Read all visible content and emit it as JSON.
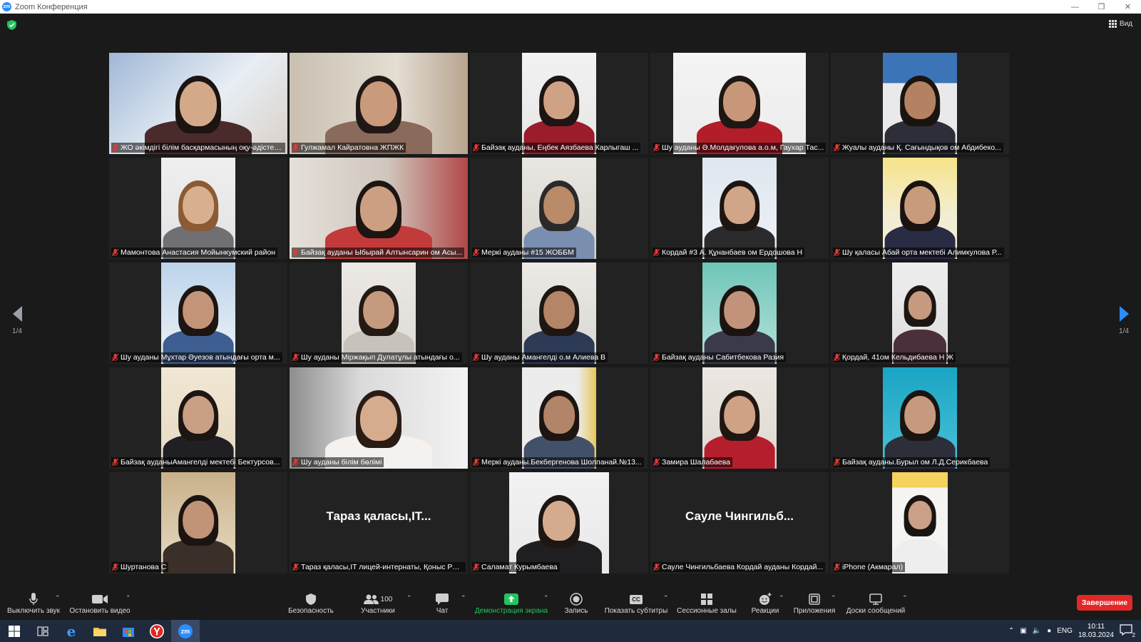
{
  "window": {
    "title": "Zoom Конференция",
    "app_icon": "zm"
  },
  "header": {
    "view_label": "Вид"
  },
  "nav": {
    "left_page": "1/4",
    "right_page": "1/4"
  },
  "participants": [
    {
      "name": "ЖО әкімдігі білім басқармасының оқу-әдістеме...",
      "active": true,
      "video": true
    },
    {
      "name": "Гулжамал Кайратовна ЖПЖК",
      "video": true
    },
    {
      "name": "Байзақ ауданы, Еңбек Аязбаева Карлыгаш ...",
      "video": true
    },
    {
      "name": "Шу ауданы Ә.Молдағулова а.о.м, Гаухар Тас...",
      "video": true
    },
    {
      "name": "Жуалы ауданы Қ. Сағындықов ом Абдибеко...",
      "video": true
    },
    {
      "name": "Мамонтова Анастасия Мойынкумский район",
      "video": true
    },
    {
      "name": "Байзақ ауданы Ыбырай Алтынсарин ом Асы...",
      "video": true
    },
    {
      "name": "Меркі ауданы #15 ЖОББМ",
      "video": true
    },
    {
      "name": "Кордай #3 А. Құнанбаев ом Ердошова Н",
      "video": true
    },
    {
      "name": "Шу қаласы Абай орта мектебі Алимкулова Р...",
      "video": true
    },
    {
      "name": "Шу ауданы Мұхтар Әуезов атындағы орта м...",
      "video": true
    },
    {
      "name": "Шу ауданы Міржақып Дулатұлы  атындағы о...",
      "video": true
    },
    {
      "name": "Шу ауданы Амангелді о.м Алиева В",
      "video": true
    },
    {
      "name": "Байзақ ауданы Сабитбекова Разия",
      "video": true
    },
    {
      "name": "Қордай, 41ом Кельдибаева Н Ж",
      "video": true
    },
    {
      "name": "Байзақ ауданыАмангелді мектебі Бектурсов...",
      "video": true
    },
    {
      "name": "Шу ауданы білім бөлімі",
      "video": true
    },
    {
      "name": "Меркі ауданы.Бекбергенова Шолпанай.№13...",
      "video": true
    },
    {
      "name": "Замира Шалабаева",
      "video": true
    },
    {
      "name": "Байзақ ауданы.Бурыл ом Л.Д.Серикбаева",
      "video": true
    },
    {
      "name": "Шуртанова С",
      "video": true
    },
    {
      "name": "Тараз қаласы,IT лицей-интернаты, Қоныс Рах...",
      "video": false,
      "display_name": "Тараз қаласы,IT..."
    },
    {
      "name": "Саламат Курымбаева",
      "video": true
    },
    {
      "name": "Сауле Чингильбаева Кордай ауданы Кордай...",
      "video": false,
      "display_name": "Сауле  Чингильб..."
    },
    {
      "name": "iPhone (Акмарал)",
      "video": true
    }
  ],
  "toolbar": {
    "mute_label": "Выключить звук",
    "video_label": "Остановить видео",
    "security_label": "Безопасность",
    "participants_label": "Участники",
    "participants_count": "100",
    "chat_label": "Чат",
    "share_label": "Демонстрация экрана",
    "record_label": "Запись",
    "captions_label": "Показать субтитры",
    "captions_icon_text": "CC",
    "breakout_label": "Сессионные залы",
    "reactions_label": "Реакции",
    "apps_label": "Приложения",
    "whiteboard_label": "Доски сообщений",
    "end_label": "Завершение"
  },
  "taskbar": {
    "language": "ENG",
    "time": "10:11",
    "date": "18.03.2024",
    "notifications": "2"
  },
  "colors": {
    "accent": "#2d8cff",
    "active_speaker": "#d8e35b",
    "end_button": "#e02828",
    "share_green": "#22c55e",
    "muted_red": "#e53935"
  }
}
